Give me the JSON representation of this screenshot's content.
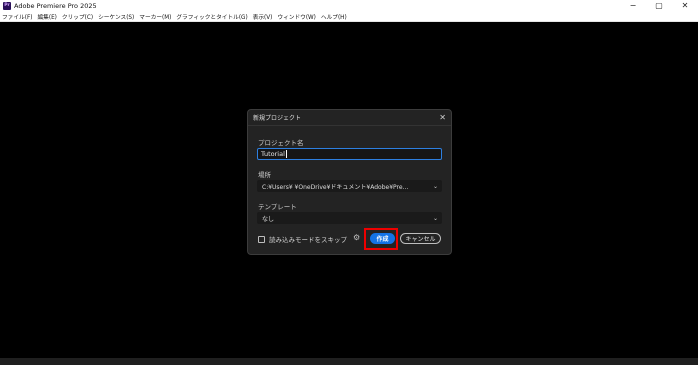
{
  "window": {
    "title": "Adobe Premiere Pro 2025",
    "icon_text": "Pr",
    "controls": {
      "minimize": "−",
      "maximize": "▢",
      "close": "✕"
    }
  },
  "menubar": {
    "items": [
      "ファイル(F)",
      "編集(E)",
      "クリップ(C)",
      "シーケンス(S)",
      "マーカー(M)",
      "グラフィックとタイトル(G)",
      "表示(V)",
      "ウィンドウ(W)",
      "ヘルプ(H)"
    ]
  },
  "dialog": {
    "title": "新規プロジェクト",
    "close_glyph": "✕",
    "project_name": {
      "label": "プロジェクト名",
      "value": "Tutorial"
    },
    "location": {
      "label": "場所",
      "value": "C:¥Users¥        ¥OneDrive¥ドキュメント¥Adobe¥Pre...",
      "chevron": "⌄"
    },
    "template": {
      "label": "テンプレート",
      "value": "なし",
      "chevron": "⌄"
    },
    "skip_import": {
      "label": "読み込みモードをスキップ",
      "checked": false
    },
    "settings_icon": "⚙",
    "buttons": {
      "create": "作成",
      "cancel": "キャンセル"
    },
    "highlight_color": "#e00000",
    "accent_color": "#1473e6"
  }
}
